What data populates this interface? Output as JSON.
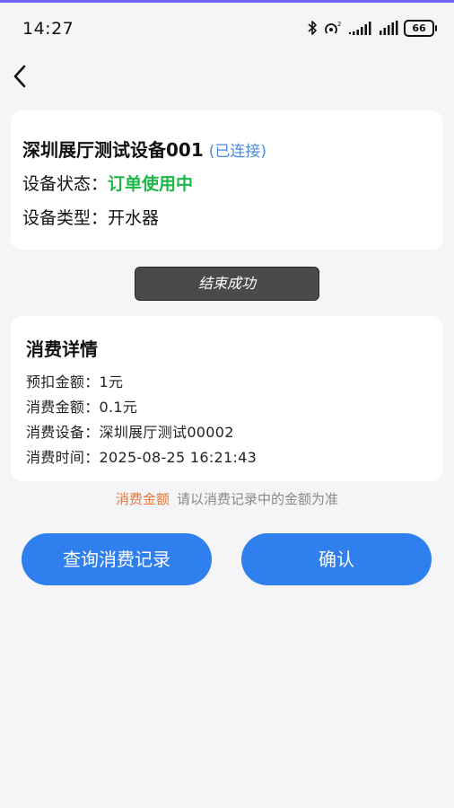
{
  "status_bar": {
    "time": "14:27",
    "icons": [
      "bluetooth-icon",
      "hotspot-icon",
      "signal-icon",
      "signal-icon",
      "battery-icon"
    ],
    "battery": "66"
  },
  "nav": {
    "back_icon": "chevron-left-icon"
  },
  "device": {
    "name": "深圳展厅测试设备001",
    "connection": "(已连接)",
    "status_label": "设备状态：",
    "status_value": "订单使用中",
    "status_color": "#1db84a",
    "type_label": "设备类型：",
    "type_value": "开水器"
  },
  "toast": {
    "text": "结束成功"
  },
  "detail": {
    "title": "消费详情",
    "rows": [
      {
        "label": "预扣金额：",
        "value": "1元"
      },
      {
        "label": "消费金额：",
        "value": "0.1元"
      },
      {
        "label": "消费设备：",
        "value": "深圳展厅测试00002"
      },
      {
        "label": "消费时间：",
        "value": "2025-08-25 16:21:43"
      }
    ]
  },
  "notice": {
    "highlight": "消费金额",
    "text": "请以消费记录中的金额为准",
    "highlight_color": "#e8773a"
  },
  "buttons": {
    "records": "查询消费记录",
    "confirm": "确认",
    "color": "#2f7fee"
  }
}
